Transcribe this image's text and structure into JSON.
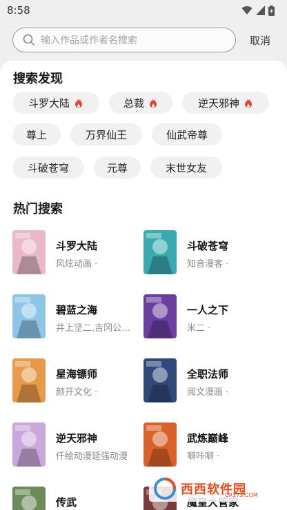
{
  "status": {
    "time": "8:58"
  },
  "search": {
    "placeholder": "输入作品或作者名搜索",
    "cancel_label": "取消"
  },
  "discover": {
    "title": "搜索发现",
    "tags": [
      {
        "label": "斗罗大陆",
        "hot": true
      },
      {
        "label": "总裁",
        "hot": true
      },
      {
        "label": "逆天邪神",
        "hot": true
      },
      {
        "label": "尊上",
        "hot": false
      },
      {
        "label": "万界仙王",
        "hot": false
      },
      {
        "label": "仙武帝尊",
        "hot": false
      },
      {
        "label": "斗破苍穹",
        "hot": false
      },
      {
        "label": "元尊",
        "hot": false
      },
      {
        "label": "末世女友",
        "hot": false
      }
    ]
  },
  "hot": {
    "title": "热门搜索",
    "items": [
      {
        "title": "斗罗大陆",
        "sub": "风炫动画 ·",
        "cover_color": "#e9b9c8"
      },
      {
        "title": "斗破苍穹",
        "sub": "知音漫客 ·",
        "cover_color": "#3aa9b0"
      },
      {
        "title": "碧蓝之海",
        "sub": "井上坚二,吉冈公…",
        "cover_color": "#8ec6e8"
      },
      {
        "title": "一人之下",
        "sub": "米二 ·",
        "cover_color": "#6a3fa0"
      },
      {
        "title": "星海镖师",
        "sub": "颜开文化 ·",
        "cover_color": "#e79a4a"
      },
      {
        "title": "全职法师",
        "sub": "阅文漫画 ·",
        "cover_color": "#2f4a7a"
      },
      {
        "title": "逆天邪神",
        "sub": "仟绘动漫延强动漫",
        "cover_color": "#c9a8dc"
      },
      {
        "title": "武炼巅峰",
        "sub": "噼咔噼 ·",
        "cover_color": "#d9622b"
      },
      {
        "title": "传武",
        "sub": "",
        "cover_color": "#6d8a5a"
      },
      {
        "title": "魔皇大管家",
        "sub": "",
        "cover_color": "#7a3b3b"
      }
    ]
  },
  "watermark": {
    "text": "西西软件园",
    "sub": "CR173.COM"
  },
  "colors": {
    "fire": "#e8432e",
    "tag_bg": "#f1f1f1",
    "panel_bg": "#ffffff",
    "page_bg": "#efefef"
  }
}
